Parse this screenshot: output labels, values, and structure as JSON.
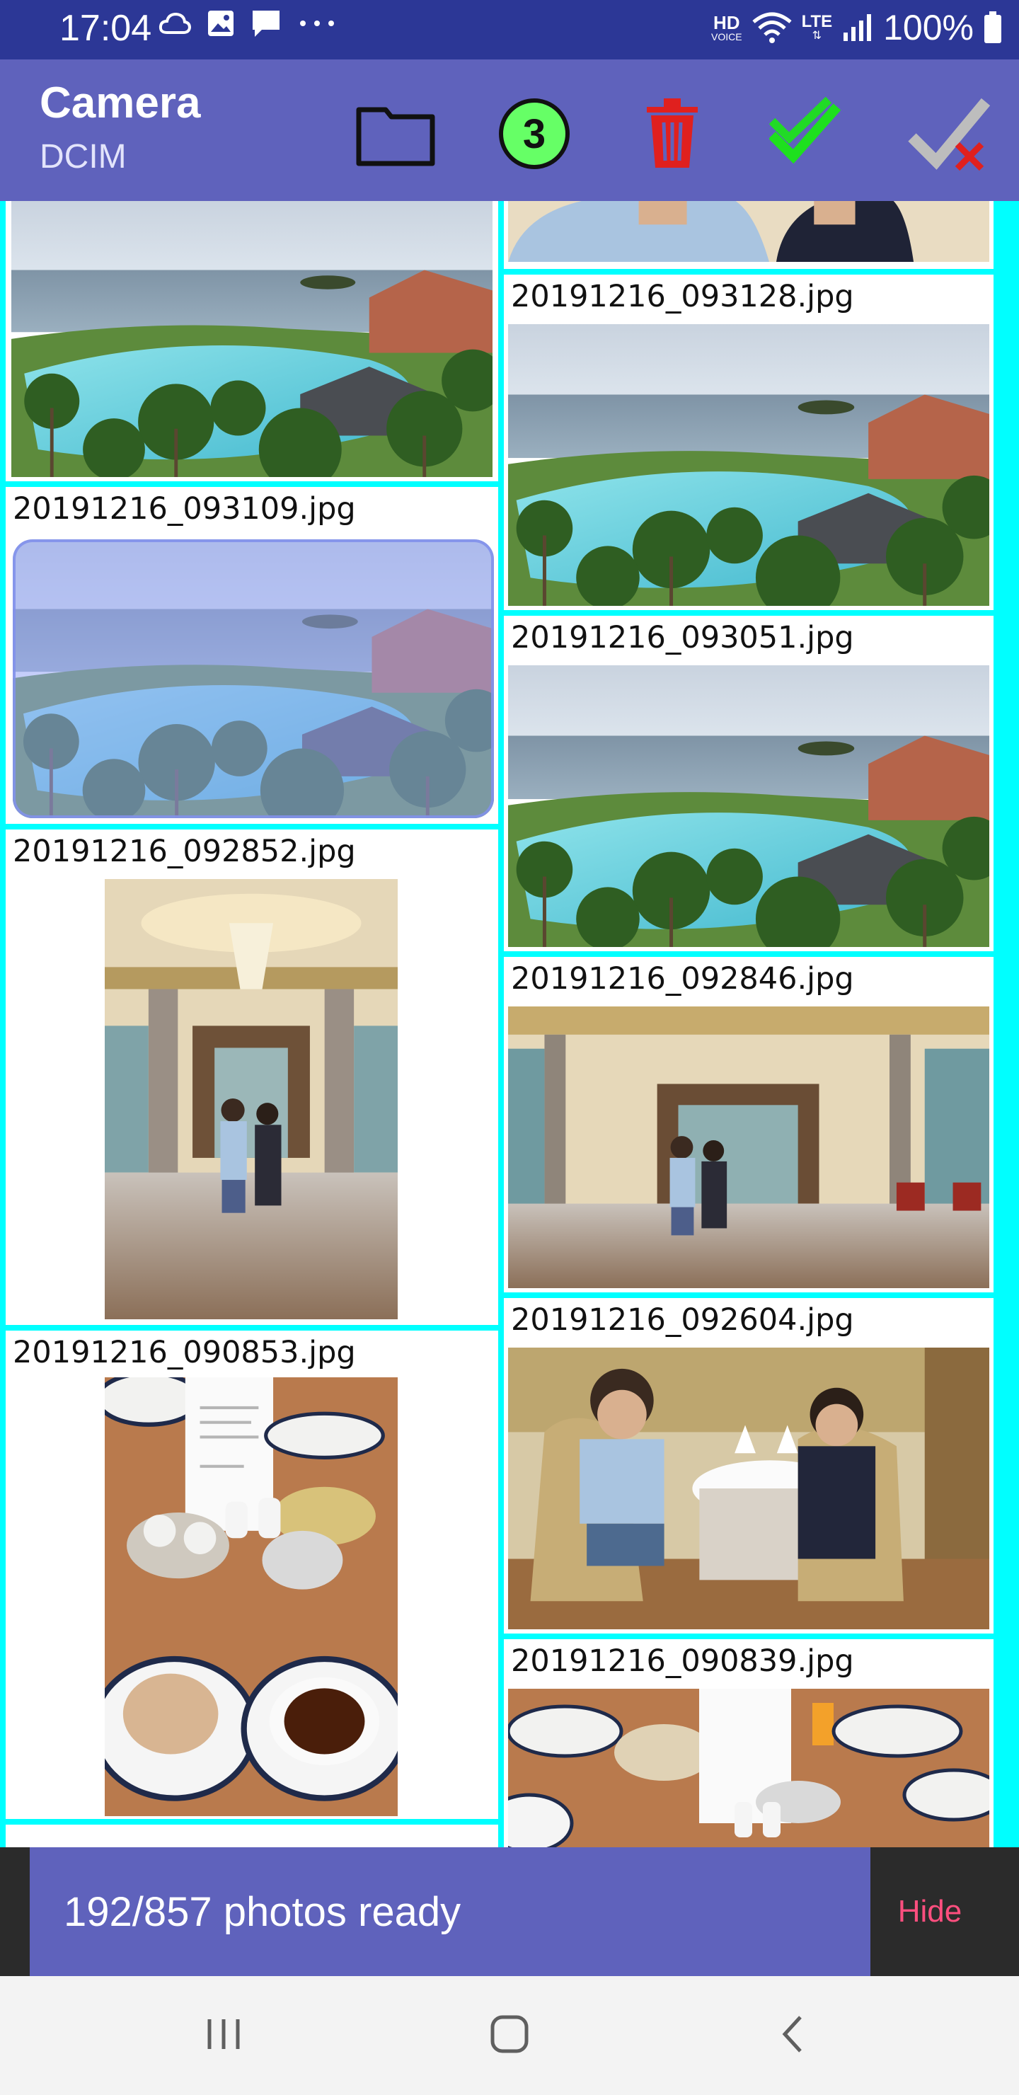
{
  "status_bar": {
    "time": "17:04",
    "left_icons": [
      "cloud-icon",
      "gallery-icon",
      "message-icon",
      "more-dots-icon"
    ],
    "right_icons": [
      "hd-voice-icon",
      "wifi-icon",
      "lte-icon",
      "signal-icon"
    ],
    "hd_label": "HD",
    "voice_label": "VOICE",
    "lte_label": "LTE",
    "battery_text": "100%"
  },
  "app_bar": {
    "title": "Camera",
    "subtitle": "DCIM",
    "selected_count": "3",
    "actions": [
      "folder-icon",
      "selected-count-badge",
      "delete-icon",
      "double-check-icon",
      "clear-selection-icon"
    ],
    "colors": {
      "background": "#5f62bc",
      "delete": "#e0201e",
      "check": "#1ee01e"
    }
  },
  "gallery": {
    "left_column": [
      {
        "filename": "",
        "photo": "resort-pool"
      },
      {
        "filename": "20191216_093109.jpg",
        "photo": "resort-pool",
        "selected": true
      },
      {
        "filename": "20191216_092852.jpg",
        "photo": "lobby-portrait"
      },
      {
        "filename": "20191216_090853.jpg",
        "photo": "breakfast-table"
      },
      {
        "filename": "",
        "photo": ""
      }
    ],
    "right_column": [
      {
        "filename": "",
        "photo": "couple-portrait"
      },
      {
        "filename": "20191216_093128.jpg",
        "photo": "resort-pool"
      },
      {
        "filename": "20191216_093051.jpg",
        "photo": "resort-pool"
      },
      {
        "filename": "20191216_092846.jpg",
        "photo": "lobby-couple"
      },
      {
        "filename": "20191216_092604.jpg",
        "photo": "dining-couple"
      },
      {
        "filename": "20191216_090839.jpg",
        "photo": "breakfast-table"
      }
    ],
    "accent_color": "#00ffff"
  },
  "snackbar": {
    "message": "192/857 photos ready",
    "action": "Hide",
    "action_color": "#ff4f7f"
  },
  "nav_bar": {
    "buttons": [
      "recent-apps-icon",
      "home-icon",
      "back-icon"
    ]
  }
}
